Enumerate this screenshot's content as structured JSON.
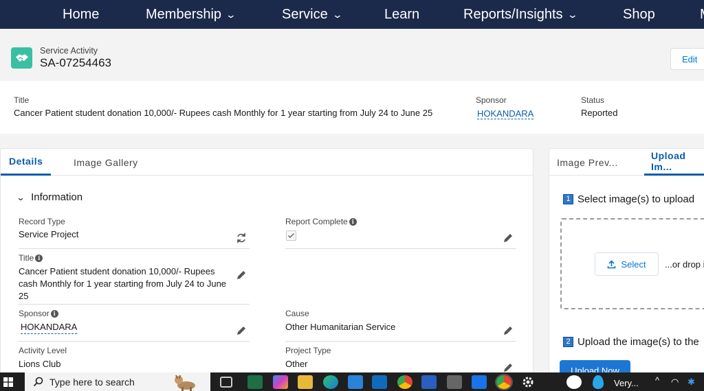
{
  "nav": {
    "items": [
      {
        "label": "Home",
        "has_menu": false
      },
      {
        "label": "Membership",
        "has_menu": true
      },
      {
        "label": "Service",
        "has_menu": true
      },
      {
        "label": "Learn",
        "has_menu": false
      },
      {
        "label": "Reports/Insights",
        "has_menu": true
      },
      {
        "label": "Shop",
        "has_menu": false
      },
      {
        "label": "M",
        "has_menu": false
      }
    ],
    "chevron": "⌄",
    "background": "#1b2a4a"
  },
  "record": {
    "icon": "handshake-icon",
    "icon_color": "#3bbfa3",
    "type_label": "Service Activity",
    "name": "SA-07254463",
    "edit_label": "Edit"
  },
  "highlights": {
    "title_label": "Title",
    "title_value": "Cancer Patient student donation 10,000/- Rupees cash Monthly for 1 year starting from July 24 to June 25",
    "sponsor_label": "Sponsor",
    "sponsor_value": "HOKANDARA",
    "status_label": "Status",
    "status_value": "Reported"
  },
  "tabs": {
    "details": "Details",
    "gallery": "Image Gallery"
  },
  "section": {
    "title": "Information",
    "fields": {
      "record_type_label": "Record Type",
      "record_type_value": "Service Project",
      "report_complete_label": "Report Complete",
      "report_complete_checked": true,
      "title_label": "Title",
      "title_value_line1": "Cancer Patient student donation 10,000/- Rupees",
      "title_value_line2": "cash Monthly for 1 year starting from July 24 to June",
      "title_value_line3": "25",
      "sponsor_label": "Sponsor",
      "sponsor_value": "HOKANDARA",
      "cause_label": "Cause",
      "cause_value": "Other Humanitarian Service",
      "activity_level_label": "Activity Level",
      "activity_level_value": "Lions Club",
      "project_type_label": "Project Type",
      "project_type_value": "Other"
    }
  },
  "upload": {
    "tab_preview": "Image Prev...",
    "tab_upload": "Upload Im...",
    "step1_num": "1",
    "step1_text": "Select image(s) to upload",
    "select_label": "Select",
    "drop_text": "...or drop i",
    "step2_num": "2",
    "step2_text": "Upload the image(s) to the",
    "upload_now": "Upload Now"
  },
  "taskbar": {
    "search_placeholder": "Type here to search",
    "tray_text": "Very..."
  },
  "colors": {
    "accent": "#0b5cab",
    "primary_button": "#1e76d4"
  }
}
